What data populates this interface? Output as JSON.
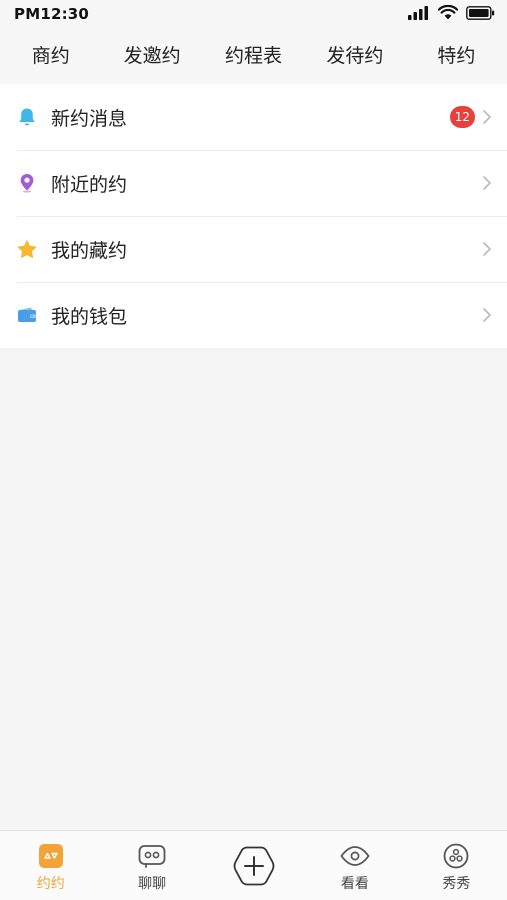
{
  "status_bar": {
    "time": "PM12:30"
  },
  "top_tabs": [
    {
      "label": "商约"
    },
    {
      "label": "发邀约"
    },
    {
      "label": "约程表"
    },
    {
      "label": "发待约"
    },
    {
      "label": "特约"
    }
  ],
  "menu": {
    "items": [
      {
        "label": "新约消息",
        "icon": "bell-icon",
        "icon_color": "#3fb7e8",
        "badge": "12"
      },
      {
        "label": "附近的约",
        "icon": "location-pin-icon",
        "icon_color": "#a45bd8"
      },
      {
        "label": "我的藏约",
        "icon": "star-icon",
        "icon_color": "#f6b731"
      },
      {
        "label": "我的钱包",
        "icon": "wallet-icon",
        "icon_color": "#4a9ee8"
      }
    ]
  },
  "bottom_nav": {
    "active_color": "#f2a437",
    "items": [
      {
        "label": "约约",
        "icon": "yueyue-icon"
      },
      {
        "label": "聊聊",
        "icon": "chat-icon"
      },
      {
        "icon": "add-icon"
      },
      {
        "label": "看看",
        "icon": "eye-icon"
      },
      {
        "label": "秀秀",
        "icon": "showcase-icon"
      }
    ]
  }
}
